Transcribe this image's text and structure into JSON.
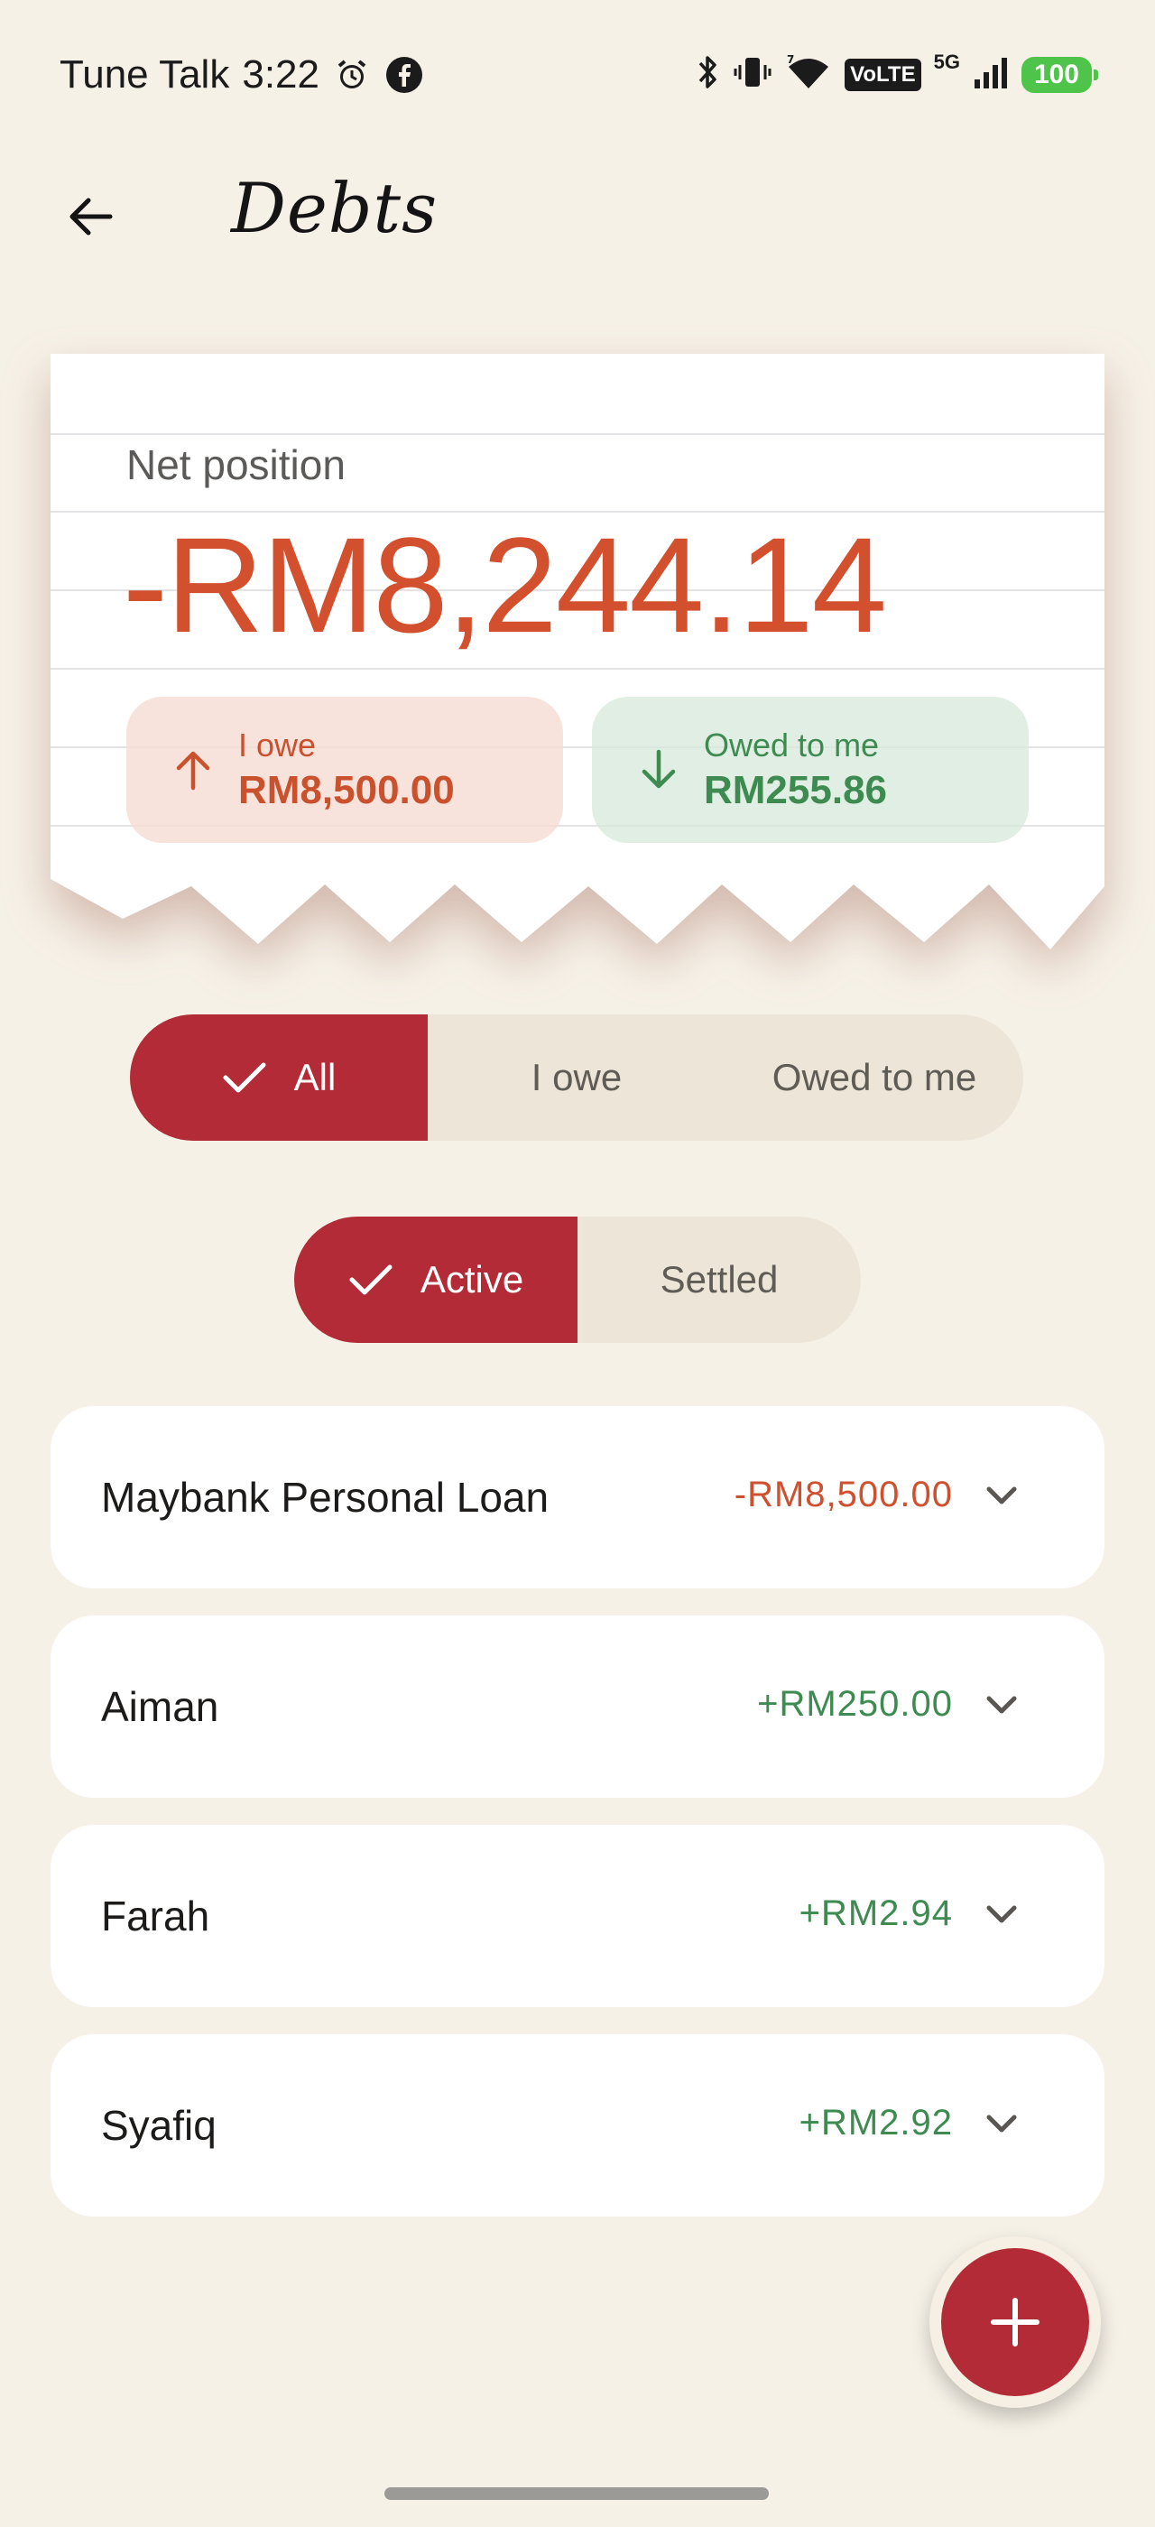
{
  "status_bar": {
    "carrier": "Tune Talk",
    "time": "3:22",
    "volte": "VoLTE",
    "network": "5G",
    "battery": "100"
  },
  "app_bar": {
    "title": "Debts"
  },
  "summary": {
    "net_label": "Net position",
    "net_value": "-RM8,244.14",
    "i_owe_label": "I owe",
    "i_owe_value": "RM8,500.00",
    "owed_to_me_label": "Owed to me",
    "owed_to_me_value": "RM255.86"
  },
  "filter_type": {
    "options": [
      "All",
      "I owe",
      "Owed to me"
    ],
    "selected": "All"
  },
  "filter_status": {
    "options": [
      "Active",
      "Settled"
    ],
    "selected": "Active"
  },
  "debts": [
    {
      "name": "Maybank Personal Loan",
      "amount": "-RM8,500.00"
    },
    {
      "name": "Aiman",
      "amount": "+RM250.00"
    },
    {
      "name": "Farah",
      "amount": "+RM2.94"
    },
    {
      "name": "Syafiq",
      "amount": "+RM2.92"
    }
  ],
  "colors": {
    "accent": "#b32b36",
    "negative": "#d3502e",
    "positive": "#3e8b52",
    "background": "#f6f1e7"
  }
}
